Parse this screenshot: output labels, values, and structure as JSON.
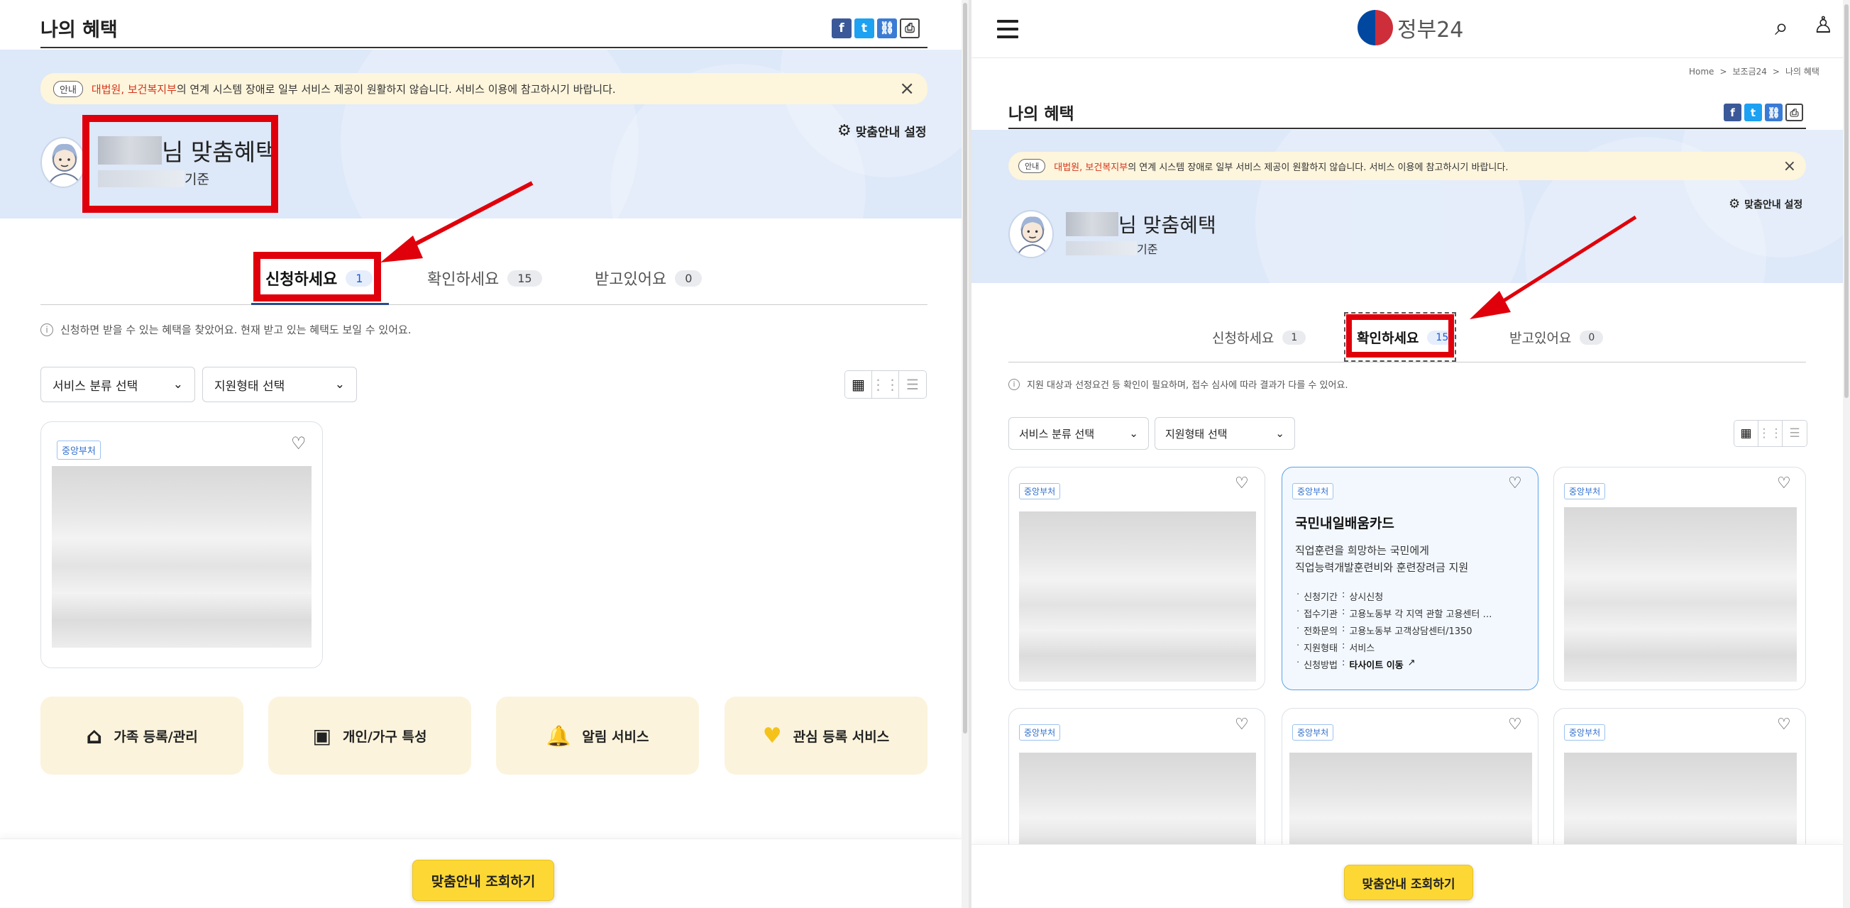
{
  "left": {
    "page_title": "나의 혜택",
    "notice": {
      "tag": "안내",
      "orgs": "대법원, 보건복지부",
      "message": "의 연계 시스템 장애로 일부 서비스 제공이 원활하지 않습니다. 서비스 이용에 참고하시기 바랍니다.",
      "close": "×"
    },
    "settings_label": "맞춤안내 설정",
    "user_suffix": "님 맞춤혜택",
    "date_suffix": "기준",
    "tabs": [
      {
        "label": "신청하세요",
        "count": "1"
      },
      {
        "label": "확인하세요",
        "count": "15"
      },
      {
        "label": "받고있어요",
        "count": "0"
      }
    ],
    "hint": "신청하면 받을 수 있는 혜택을 찾았어요. 현재 받고 있는 혜택도 보일 수 있어요.",
    "filters": {
      "service": "서비스 분류 선택",
      "support": "지원형태 선택"
    },
    "card": {
      "badge": "중앙부처"
    },
    "features": [
      {
        "label": "가족 등록/관리",
        "icon": "house-icon"
      },
      {
        "label": "개인/가구 특성",
        "icon": "id-card-icon"
      },
      {
        "label": "알림 서비스",
        "icon": "bell-icon"
      },
      {
        "label": "관심 등록 서비스",
        "icon": "heart-icon"
      }
    ],
    "cta": "맞춤안내 조회하기"
  },
  "right": {
    "logo_text": "정부24",
    "breadcrumb": [
      "Home",
      "보조금24",
      "나의 혜택"
    ],
    "breadcrumb_sep": ">",
    "page_title": "나의 혜택",
    "notice": {
      "tag": "안내",
      "orgs": "대법원, 보건복지부",
      "message": "의 연계 시스템 장애로 일부 서비스 제공이 원활하지 않습니다. 서비스 이용에 참고하시기 바랍니다.",
      "close": "×"
    },
    "settings_label": "맞춤안내 설정",
    "user_suffix": "님 맞춤혜택",
    "date_suffix": "기준",
    "tabs": [
      {
        "label": "신청하세요",
        "count": "1"
      },
      {
        "label": "확인하세요",
        "count": "15"
      },
      {
        "label": "받고있어요",
        "count": "0"
      }
    ],
    "hint": "지원 대상과 선정요건 등 확인이 필요하며, 접수 심사에 따라 결과가 다를 수 있어요.",
    "filters": {
      "service": "서비스 분류 선택",
      "support": "지원형태 선택"
    },
    "card_badge": "중앙부처",
    "featured": {
      "badge": "중앙부처",
      "title": "국민내일배움카드",
      "desc1": "직업훈련을 희망하는 국민에게",
      "desc2": "직업능력개발훈련비와 훈련장려금 지원",
      "items": [
        {
          "key": "신청기간",
          "value": "상시신청"
        },
        {
          "key": "접수기관",
          "value": "고용노동부 각 지역 관할 고용센터 …"
        },
        {
          "key": "전화문의",
          "value": "고용노동부 고객상담센터/1350"
        },
        {
          "key": "지원형태",
          "value": "서비스"
        }
      ],
      "method_key": "신청방법",
      "method_value": "타사이트 이동"
    },
    "cta": "맞춤안내 조회하기"
  },
  "colors": {
    "accent_red": "#e0000b",
    "cta_yellow": "#fdd835",
    "hero_blue": "#dde8f8",
    "notice_bg": "#fdf5dc",
    "feature_bg": "#fbf3dc",
    "active_count": "#1b5fd6"
  }
}
